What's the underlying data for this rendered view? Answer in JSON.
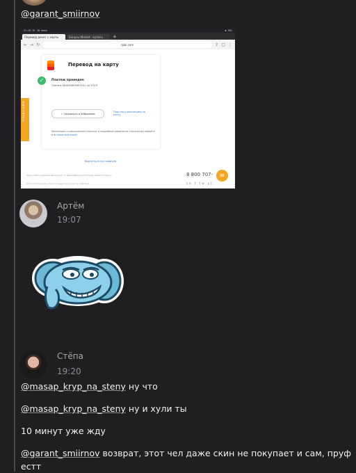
{
  "messages": {
    "top_mention": "@garant_smiirnov",
    "artem": {
      "name": "Артём",
      "time": "19:07"
    },
    "stepa": {
      "name": "Стёпа",
      "time": "19:20",
      "lines": [
        {
          "mention": "@masap_kryp_na_steny",
          "text": " ну что"
        },
        {
          "mention": "@masap_kryp_na_steny",
          "text": " ну и хули ты"
        },
        {
          "mention": "",
          "text": "10 минут уже жду"
        },
        {
          "mention": "@garant_smiirnov",
          "text": " возврат, этот чел даже скин не покупает и сам, пруф естт"
        }
      ]
    }
  },
  "screenshot": {
    "status_left": "21:26 Пт 28 июня",
    "status_right": "◆ 96%",
    "tabs": [
      "Перевод денег с карты",
      "Бонусы Market - купить"
    ],
    "url": "qiwi.com",
    "title": "Перевод на карту",
    "status": "Платеж проведен",
    "details": "Платеж №4090894891541 на 200 ₽",
    "save_button": "Сохранить в Избранное",
    "link": "Прислать квитанцию на почту",
    "info": "Квитанцию о совершенном платеже и подробные реквизиты платежа вы найдете в ",
    "info_link": "истории платежей",
    "side_tab": "Отзыв о сайте",
    "back": "Вернуться на главную",
    "footer": "Карта QIWI кошелька   Безопасность   Идентификация   Помощь   Лимиты   Офисы",
    "footer2": "QIWI 2023 Кошелёк   Новости   Защита   Контакты   QIWI Bank",
    "phone": "8 800 707-",
    "socials": "vk f tw yt"
  }
}
